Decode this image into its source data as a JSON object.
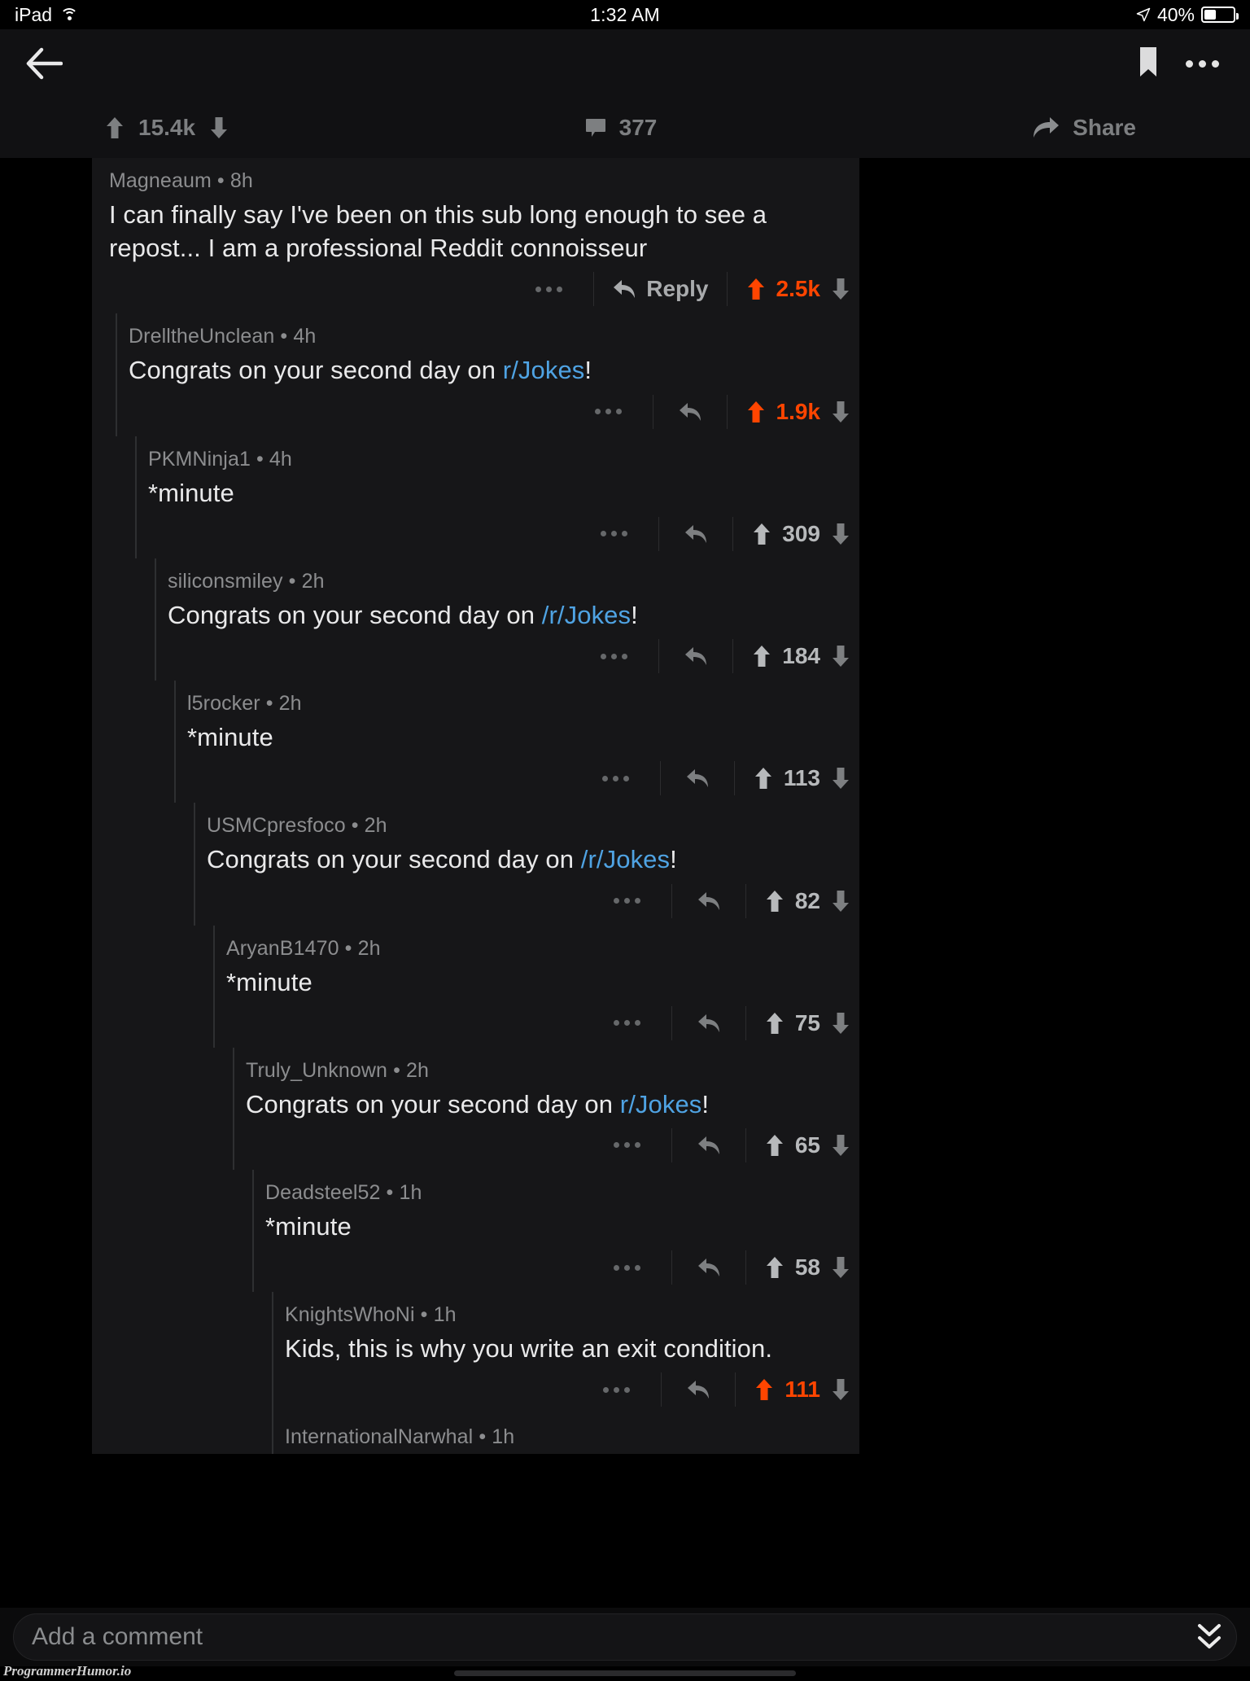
{
  "status_bar": {
    "device": "iPad",
    "wifi_icon": "wifi-icon",
    "time": "1:32 AM",
    "location_icon": "location-arrow-icon",
    "battery_percent": "40%",
    "battery_icon": "battery-icon"
  },
  "nav_bar": {
    "back_icon": "back-arrow-icon",
    "bookmark_icon": "bookmark-icon",
    "overflow_icon": "more-horizontal-icon"
  },
  "action_bar": {
    "upvote_icon": "upvote-arrow-icon",
    "score": "15.4k",
    "downvote_icon": "downvote-arrow-icon",
    "comment_icon": "comment-bubble-icon",
    "comment_count": "377",
    "share_icon": "share-arrow-icon",
    "share_label": "Share"
  },
  "colors": {
    "accent_orange": "#ff4500",
    "link_blue": "#4fa3e3",
    "card_bg": "#161618",
    "page_bg": "#000000"
  },
  "comments": [
    {
      "author": "Magneaum",
      "age": "8h",
      "text_pre": "I can finally say I've been on this sub long enough to see a repost... I am a professional Reddit connoisseur",
      "link": "",
      "text_post": "",
      "score": "2.5k",
      "hot": true,
      "reply_label": "Reply",
      "depth": 0
    },
    {
      "author": "DrelltheUnclean",
      "age": "4h",
      "text_pre": "Congrats on your second day on ",
      "link": "r/Jokes",
      "text_post": "!",
      "score": "1.9k",
      "hot": true,
      "reply_label": "",
      "depth": 1
    },
    {
      "author": "PKMNinja1",
      "age": "4h",
      "text_pre": "*minute",
      "link": "",
      "text_post": "",
      "score": "309",
      "hot": false,
      "reply_label": "",
      "depth": 2
    },
    {
      "author": "siliconsmiley",
      "age": "2h",
      "text_pre": "Congrats on your second day on ",
      "link": "/r/Jokes",
      "text_post": "!",
      "score": "184",
      "hot": false,
      "reply_label": "",
      "depth": 3
    },
    {
      "author": "l5rocker",
      "age": "2h",
      "text_pre": "*minute",
      "link": "",
      "text_post": "",
      "score": "113",
      "hot": false,
      "reply_label": "",
      "depth": 4
    },
    {
      "author": "USMCpresfoco",
      "age": "2h",
      "text_pre": "Congrats on your second day on ",
      "link": "/r/Jokes",
      "text_post": "!",
      "score": "82",
      "hot": false,
      "reply_label": "",
      "depth": 5
    },
    {
      "author": "AryanB1470",
      "age": "2h",
      "text_pre": "*minute",
      "link": "",
      "text_post": "",
      "score": "75",
      "hot": false,
      "reply_label": "",
      "depth": 6
    },
    {
      "author": "Truly_Unknown",
      "age": "2h",
      "text_pre": "Congrats on your second day on ",
      "link": "r/Jokes",
      "text_post": "!",
      "score": "65",
      "hot": false,
      "reply_label": "",
      "depth": 7
    },
    {
      "author": "Deadsteel52",
      "age": "1h",
      "text_pre": "*minute",
      "link": "",
      "text_post": "",
      "score": "58",
      "hot": false,
      "reply_label": "",
      "depth": 8
    },
    {
      "author": "KnightsWhoNi",
      "age": "1h",
      "text_pre": "Kids, this is why you write an exit condition.",
      "link": "",
      "text_post": "",
      "score": "111",
      "hot": true,
      "reply_label": "",
      "depth": 9
    },
    {
      "author": "InternationalNarwhal",
      "age": "1h",
      "text_pre": "",
      "link": "",
      "text_post": "",
      "score": "",
      "hot": false,
      "reply_label": "",
      "depth": 9
    }
  ],
  "composer": {
    "placeholder": "Add a comment",
    "collapse_icon": "double-chevron-down-icon"
  },
  "watermark": "ProgrammerHumor.io"
}
